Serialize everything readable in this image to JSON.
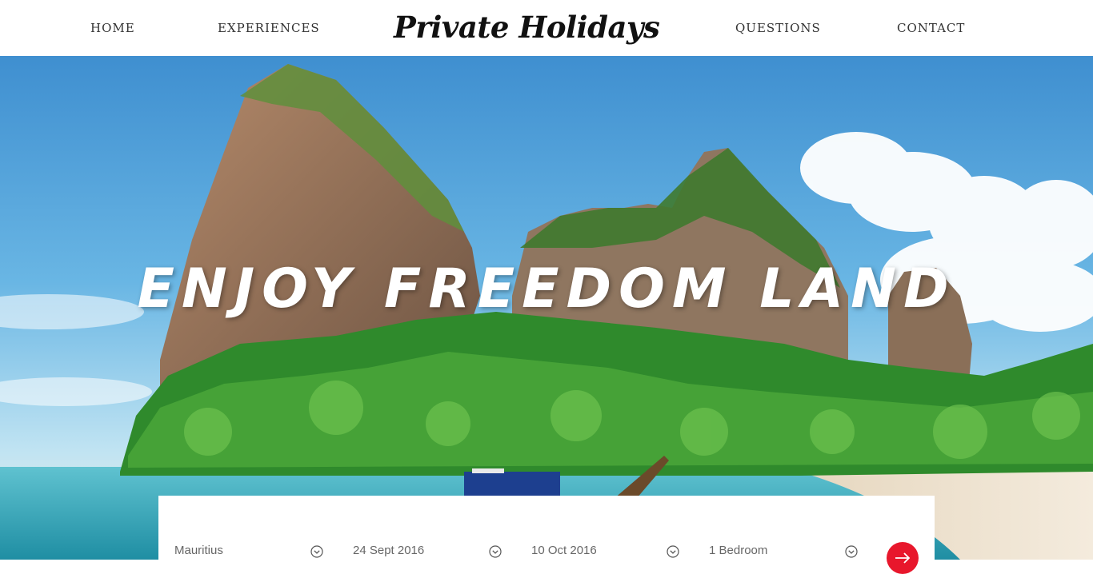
{
  "nav": {
    "home": "HOME",
    "experiences": "EXPERIENCES",
    "questions": "QUESTIONS",
    "contact": "CONTACT"
  },
  "logo": "Private Holidays",
  "hero": {
    "title": "ENJOY FREEDOM LAND"
  },
  "booking": {
    "destination": "Mauritius",
    "check_in": "24 Sept 2016",
    "check_out": "10 Oct 2016",
    "rooms": "1 Bedroom"
  },
  "icons": {
    "dropdown": "chevron-down-circle-icon",
    "submit": "arrow-right-icon"
  },
  "colors": {
    "accent": "#e8172c",
    "nav_text": "#333333"
  }
}
